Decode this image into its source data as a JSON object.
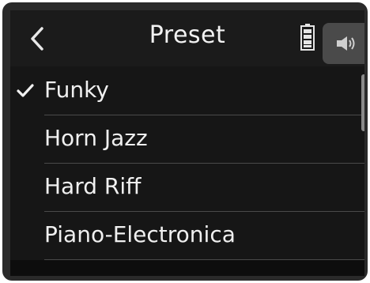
{
  "header": {
    "title": "Preset"
  },
  "icons": {
    "back": "chevron-left-icon",
    "battery": "battery-icon",
    "speaker": "speaker-icon",
    "check": "checkmark-icon"
  },
  "presets": [
    {
      "label": "Funky",
      "selected": true
    },
    {
      "label": "Horn Jazz",
      "selected": false
    },
    {
      "label": "Hard Riff",
      "selected": false
    },
    {
      "label": "Piano-Electronica",
      "selected": false
    }
  ],
  "colors": {
    "background": "#161616",
    "text": "#f0f0f0",
    "speaker_tab": "#4a4a4a"
  }
}
